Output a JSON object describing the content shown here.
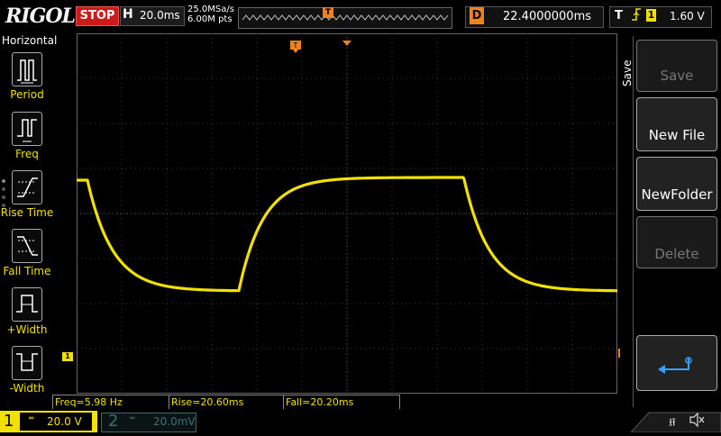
{
  "brand": "RIGOL",
  "run_state": "STOP",
  "horizontal": {
    "letter": "H",
    "timebase": "20.0ms"
  },
  "acquisition": {
    "sample_rate": "25.0MSa/s",
    "memory_depth": "6.00M pts"
  },
  "trigger_marker": "T",
  "delay": {
    "letter": "D",
    "value": "22.4000000ms"
  },
  "trigger": {
    "letter": "T",
    "edge_icon": "rising-edge-icon",
    "source": "1",
    "level": "1.60 V"
  },
  "left_menu": {
    "title": "Horizontal",
    "items": [
      {
        "label": "Period",
        "icon": "period-icon"
      },
      {
        "label": "Freq",
        "icon": "freq-icon"
      },
      {
        "label": "Rise Time",
        "icon": "rise-time-icon"
      },
      {
        "label": "Fall Time",
        "icon": "fall-time-icon"
      },
      {
        "label": "+Width",
        "icon": "pos-width-icon"
      },
      {
        "label": "-Width",
        "icon": "neg-width-icon"
      }
    ]
  },
  "right_menu": {
    "title": "Save",
    "buttons": [
      {
        "label": "Save",
        "enabled": false
      },
      {
        "label": "New File",
        "enabled": true
      },
      {
        "label": "NewFolder",
        "enabled": true
      },
      {
        "label": "Delete",
        "enabled": false
      }
    ],
    "return_icon": "return-arrow-icon"
  },
  "measurements": [
    {
      "text": "Freq=5.98 Hz"
    },
    {
      "text": "Rise=20.60ms"
    },
    {
      "text": "Fall=20.20ms"
    }
  ],
  "channels": [
    {
      "number": "1",
      "scale": "20.0 V",
      "active": true,
      "color": "#f2e000"
    },
    {
      "number": "2",
      "scale": "20.0mV",
      "active": false,
      "color": "#3c6e73"
    }
  ],
  "markers": {
    "ch1_ground": "1",
    "trigger_level_arrow": "◄"
  },
  "status_icons": {
    "usb": "usb-icon",
    "sound": "speaker-muted-icon"
  },
  "colors": {
    "trace": "#f2e000",
    "accent_orange": "#f0821e",
    "stop_red": "#cc1b1b",
    "grid": "#3a3a3a"
  }
}
